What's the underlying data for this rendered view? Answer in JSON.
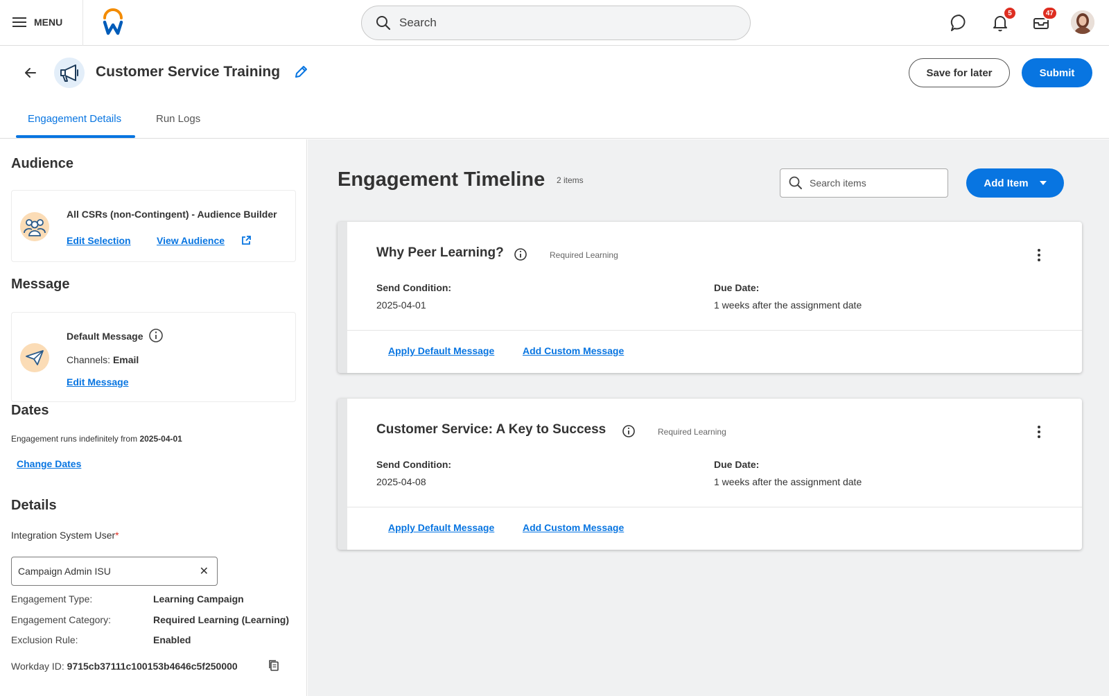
{
  "topbar": {
    "menu_label": "MENU",
    "search_placeholder": "Search",
    "notifications_count": "5",
    "inbox_count": "47"
  },
  "header": {
    "title": "Customer Service Training",
    "save_label": "Save for later",
    "submit_label": "Submit"
  },
  "tabs": [
    {
      "label": "Engagement Details",
      "active": true
    },
    {
      "label": "Run Logs",
      "active": false
    }
  ],
  "audience": {
    "title": "Audience",
    "name": "All CSRs (non-Contingent) - Audience Builder",
    "edit_link": "Edit Selection",
    "view_link": "View Audience"
  },
  "message": {
    "title": "Message",
    "name": "Default Message",
    "channels_label": "Channels:",
    "channels_value": "Email",
    "edit_link": "Edit Message"
  },
  "dates": {
    "title": "Dates",
    "text": "Engagement runs indefinitely from",
    "date": "2025-04-01",
    "change_link": "Change Dates"
  },
  "details": {
    "title": "Details",
    "isu_label": "Integration System User",
    "isu_value": "Campaign Admin ISU",
    "rows": [
      {
        "label": "Engagement Type:",
        "value": "Learning Campaign"
      },
      {
        "label": "Engagement Category:",
        "value": "Required Learning (Learning)"
      },
      {
        "label": "Exclusion Rule:",
        "value": "Enabled"
      }
    ],
    "workday_id_label": "Workday ID:",
    "workday_id_value": "9715cb37111c100153b4646c5f250000"
  },
  "timeline": {
    "title": "Engagement Timeline",
    "count": "2 items",
    "search_placeholder": "Search items",
    "add_label": "Add Item",
    "items": [
      {
        "title": "Why Peer Learning?",
        "tag": "Required Learning",
        "send_label": "Send Condition:",
        "send_value": "2025-04-01",
        "due_label": "Due Date:",
        "due_value": "1 weeks after the assignment date",
        "apply_link": "Apply Default Message",
        "custom_link": "Add Custom Message"
      },
      {
        "title": "Customer Service: A Key to Success",
        "tag": "Required Learning",
        "send_label": "Send Condition:",
        "send_value": "2025-04-08",
        "due_label": "Due Date:",
        "due_value": "1 weeks after the assignment date",
        "apply_link": "Apply Default Message",
        "custom_link": "Add Custom Message"
      }
    ]
  },
  "colors": {
    "accent": "#0875e1",
    "badge": "#de2e21",
    "background": "#f0f1f2"
  }
}
